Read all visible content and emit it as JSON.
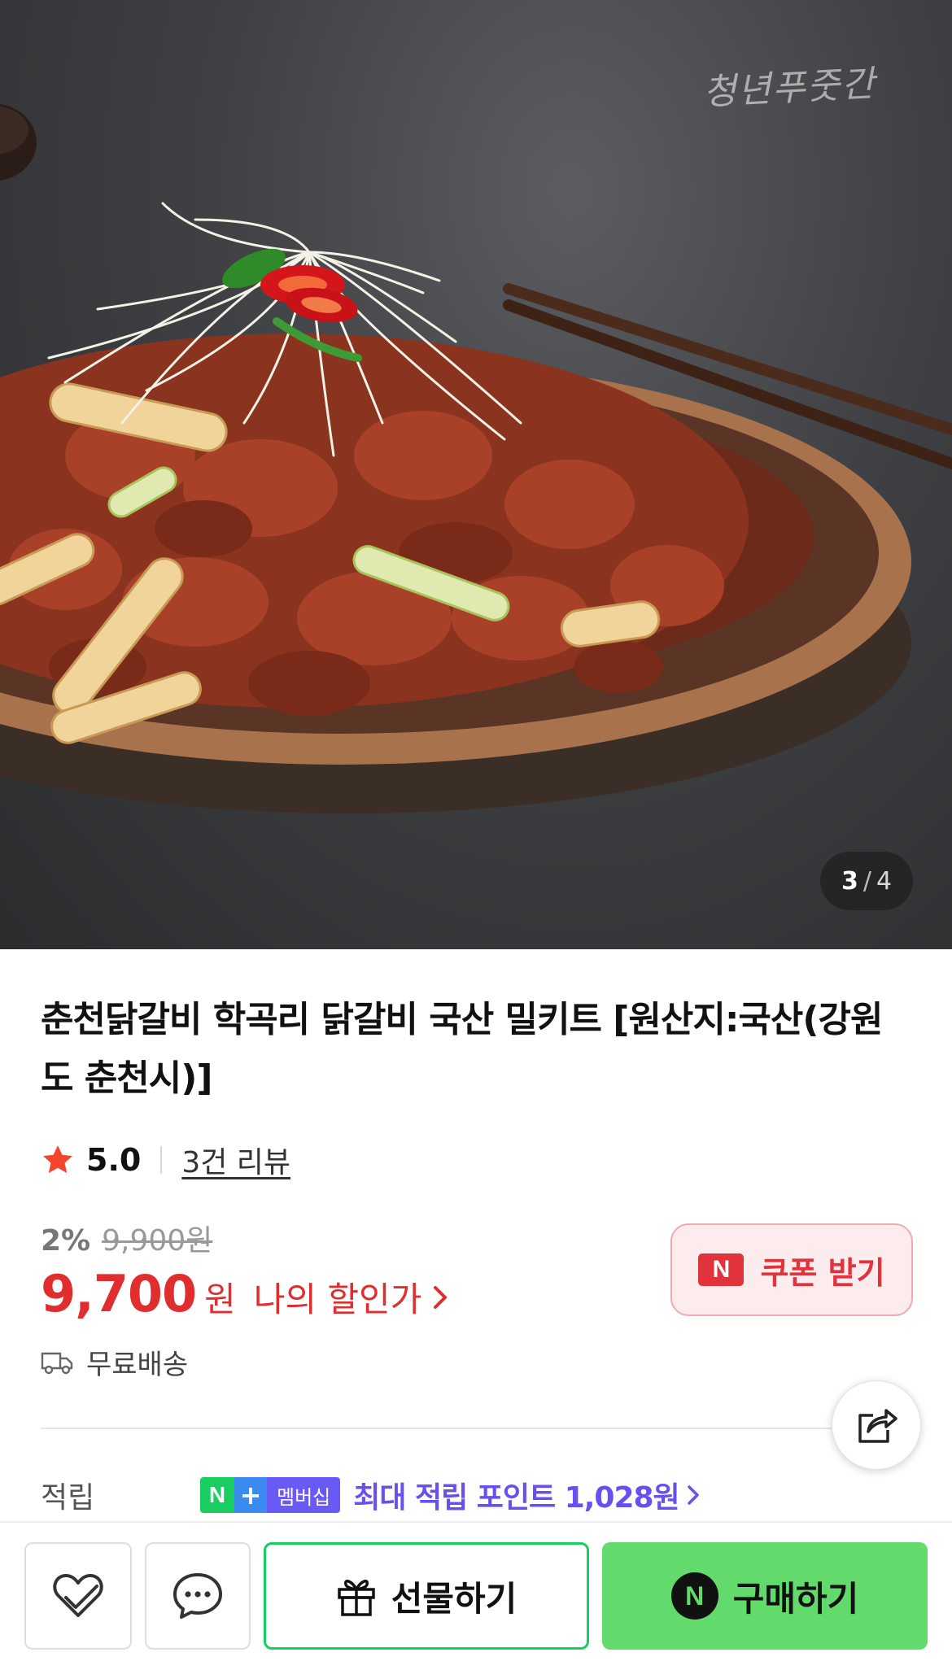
{
  "hero": {
    "watermark": "청년푸줏간",
    "page_current": "3",
    "page_separator": "/",
    "page_total": "4"
  },
  "product": {
    "title": "춘천닭갈비 학곡리 닭갈비 국산 밀키트 [원산지:국산(강원도 춘천시)]",
    "rating": "5.0",
    "review_link": "3건 리뷰",
    "discount_percent": "2%",
    "original_price": "9,900원",
    "price": "9,700",
    "price_unit": "원",
    "my_discount_label": "나의 할인가",
    "coupon_badge": "N",
    "coupon_label": "쿠폰 받기",
    "shipping": "무료배송"
  },
  "points": {
    "label": "적립",
    "badge_n": "N",
    "badge_plus": "+",
    "badge_membership": "멤버십",
    "text": "최대 적립 포인트 1,028원"
  },
  "bottom_bar": {
    "gift_label": "선물하기",
    "buy_badge": "N",
    "buy_label": "구매하기"
  },
  "colors": {
    "price_red": "#e02d2d",
    "naver_green": "#19ce60",
    "buy_green": "#63db6c",
    "points_purple": "#6a4ff0"
  }
}
